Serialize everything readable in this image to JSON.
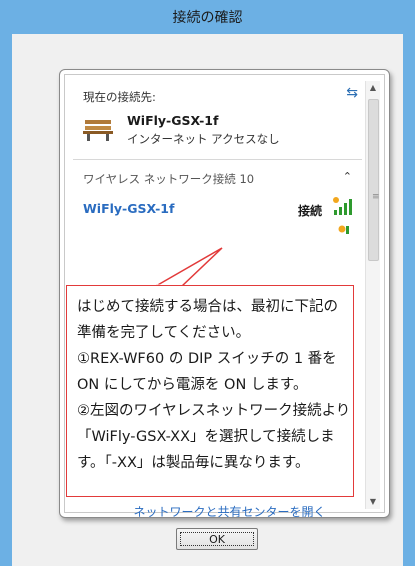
{
  "window": {
    "title": "接続の確認"
  },
  "network_panel": {
    "current_connection_label": "現在の接続先:",
    "current_network_name": "WiFly-GSX-1f",
    "current_network_status": "インターネット アクセスなし",
    "wireless_section_label": "ワイヤレス ネットワーク接続 10",
    "wifi_item_name": "WiFly-GSX-1f",
    "wifi_item_status": "接続",
    "sharing_center_link": "ネットワークと共有センターを開く"
  },
  "callout": {
    "lines": [
      "はじめて接続する場合は、最初に下記の",
      "準備を完了してください。",
      "①REX-WF60 の DIP スイッチの 1 番を",
      "ON にしてから電源を ON します。",
      "②左図のワイヤレスネットワーク接続より",
      "「WiFly-GSX-XX」を選択して接続しま",
      "す。「-XX」は製品毎に異なります。"
    ],
    "border_color": "#e23a3a"
  },
  "buttons": {
    "ok_label": "OK"
  },
  "colors": {
    "title_bar": "#6cb0e4",
    "link": "#2a6cc0",
    "signal": "#2e9a2e"
  },
  "icons": [
    "sync-icon",
    "bench-icon",
    "chevron-up-icon",
    "signal-icon",
    "scroll-up-icon",
    "scroll-down-icon"
  ]
}
